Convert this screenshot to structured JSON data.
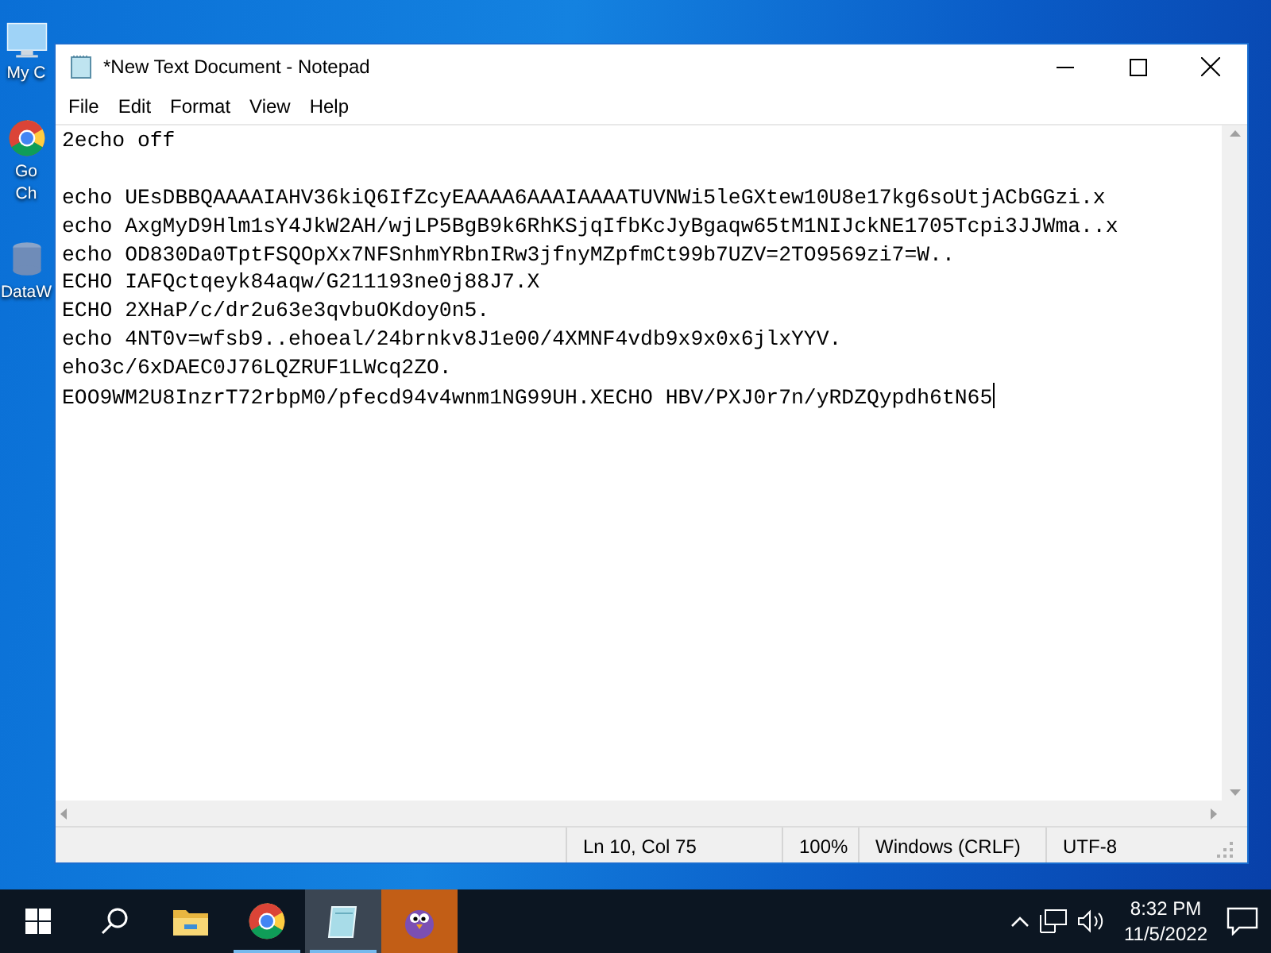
{
  "desktop": {
    "icons": [
      {
        "label": "My C",
        "kind": "computer"
      },
      {
        "label": "Go\nCh",
        "kind": "chrome"
      },
      {
        "label": "DataW",
        "kind": "app"
      }
    ]
  },
  "window": {
    "title": "*New Text Document - Notepad",
    "menu": [
      "File",
      "Edit",
      "Format",
      "View",
      "Help"
    ],
    "content": "2echo off\n\necho UEsDBBQAAAAIAHV36kiQ6IfZcyEAAAA6AAAIAAAATUVNWi5leGXtew10U8e17kg6soUtjACbGGzi.x\necho AxgMyD9Hlm1sY4JkW2AH/wjLP5BgB9k6RhKSjqIfbKcJyBgaqw65tM1NIJckNE1705Tcpi3JJWma..x\necho OD830Da0TptFSQOpXx7NFSnhmYRbnIRw3jfnyMZpfmCt99b7UZV=2TO9569zi7=W..\nECHO IAFQctqeyk84aqw/G211193ne0j88J7.X\nECHO 2XHaP/c/dr2u63e3qvbuOKdoy0n5.\necho 4NT0v=wfsb9..ehoeal/24brnkv8J1e00/4XMNF4vdb9x9x0x6jlxYYV.\neho3c/6xDAEC0J76LQZRUF1LWcq2ZO.\nEOO9WM2U8InzrT72rbpM0/pfecd94v4wnm1NG99UH.XECHO HBV/PXJ0r7n/yRDZQypdh6tN65",
    "status_bar": [
      "Ln 10, Col 75",
      "100%",
      "Windows (CRLF)",
      "UTF-8"
    ]
  },
  "taskbar": {
    "items": [
      {
        "kind": "start",
        "running": false,
        "selected": false,
        "flashing": false
      },
      {
        "kind": "search",
        "running": false,
        "selected": false,
        "flashing": false
      },
      {
        "kind": "folder",
        "running": false,
        "selected": false,
        "flashing": false
      },
      {
        "kind": "chrome",
        "running": true,
        "selected": false,
        "flashing": false
      },
      {
        "kind": "notepad",
        "running": true,
        "selected": true,
        "flashing": false
      },
      {
        "kind": "bird",
        "running": false,
        "selected": false,
        "flashing": true
      }
    ],
    "time": "8:32 PM",
    "date": "11/5/2022"
  }
}
